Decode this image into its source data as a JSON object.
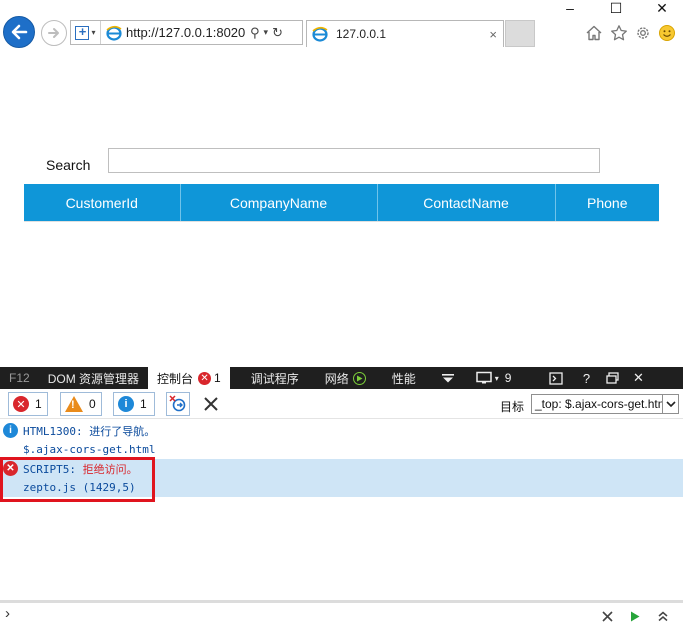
{
  "browser": {
    "url": "http://127.0.0.1:8020",
    "tab_title": "127.0.0.1",
    "tab_close": "×"
  },
  "window_controls": {
    "minimize": "–",
    "maximize": "☐",
    "close": "✕"
  },
  "page": {
    "search_label": "Search",
    "search_value": "",
    "table_headers": [
      "CustomerId",
      "CompanyName",
      "ContactName",
      "Phone"
    ]
  },
  "devtools": {
    "tabs": {
      "f12": "F12",
      "dom": "DOM 资源管理器",
      "console": "控制台",
      "console_error_count": "1",
      "debugger": "调试程序",
      "network": "网络",
      "performance": "性能",
      "emulation_count": "9"
    },
    "right_icons": {
      "help": "?",
      "close": "✕"
    },
    "filters": {
      "errors": "1",
      "warnings": "0",
      "messages": "1"
    },
    "target_label": "目标",
    "target_value": "_top: $.ajax-cors-get.htm",
    "messages": [
      {
        "type": "info",
        "text": "HTML1300: 进行了导航。",
        "source": "$.ajax-cors-get.html"
      },
      {
        "type": "error",
        "text": "SCRIPT5: 拒绝访问。",
        "source": "zepto.js (1429,5)"
      }
    ],
    "prompt": "›"
  },
  "colors": {
    "accent_blue": "#0f96d8",
    "devtools_bar": "#1f1f1f",
    "error_red": "#d9262c",
    "warning_orange": "#e98b1b",
    "info_blue": "#1e88d8",
    "highlight_red": "#e0141e",
    "selected_row": "#cfe5f6"
  }
}
